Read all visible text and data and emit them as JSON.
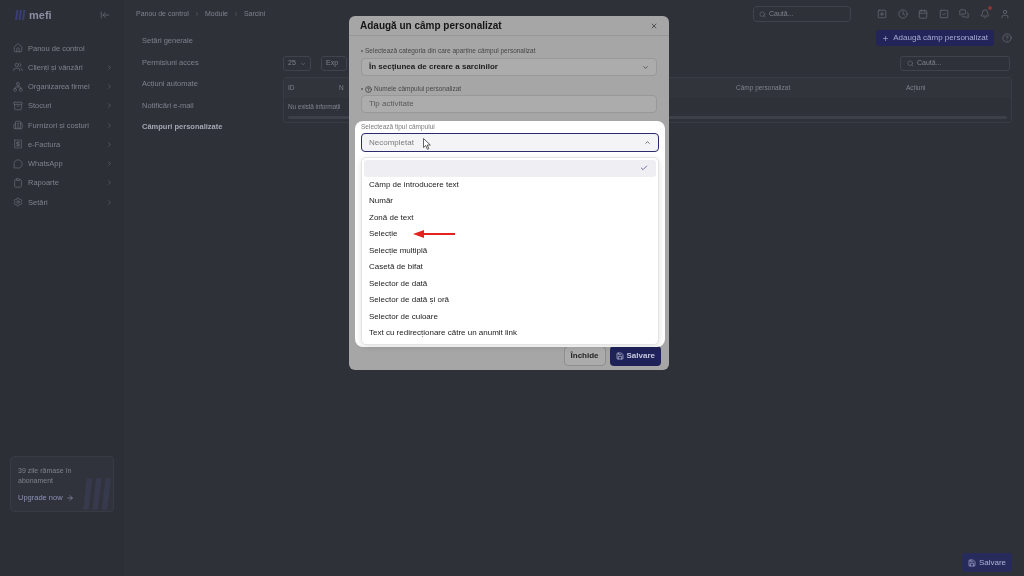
{
  "sidebar": {
    "logo": "mefi",
    "items": [
      {
        "label": "Panou de control",
        "has_submenu": false
      },
      {
        "label": "Clienți și vânzări",
        "has_submenu": true
      },
      {
        "label": "Organizarea firmei",
        "has_submenu": true
      },
      {
        "label": "Stocuri",
        "has_submenu": true
      },
      {
        "label": "Furnizori și costuri",
        "has_submenu": true
      },
      {
        "label": "e-Factura",
        "has_submenu": true
      },
      {
        "label": "WhatsApp",
        "has_submenu": true
      },
      {
        "label": "Rapoarte",
        "has_submenu": true
      },
      {
        "label": "Setări",
        "has_submenu": true
      }
    ],
    "promo": {
      "text": "39 zile rămase în abonament",
      "link": "Upgrade now"
    }
  },
  "top_bar": {
    "breadcrumb": [
      "Panou de control",
      "Module",
      "Sarcini"
    ],
    "search": {
      "placeholder": "Caută..."
    }
  },
  "settings_menu": {
    "items": [
      {
        "label": "Setări generale",
        "selected": false
      },
      {
        "label": "Permisiuni acces",
        "selected": false
      },
      {
        "label": "Acțiuni automate",
        "selected": false
      },
      {
        "label": "Notificări e-mail",
        "selected": false
      },
      {
        "label": "Câmpuri personalizate",
        "selected": true
      }
    ]
  },
  "page": {
    "add_button": "Adaugă câmp personalizat",
    "toolbar": {
      "page_size": "25",
      "export_button": "Exp",
      "search": {
        "placeholder": "Caută..."
      }
    },
    "table": {
      "columns": [
        "ID",
        "N",
        "Câmp personalizat",
        "Acțiuni"
      ],
      "empty_message": "Nu există informații"
    },
    "save_button": "Salvare"
  },
  "modal": {
    "title": "Adaugă un câmp personalizat",
    "fields": [
      {
        "kind": "select",
        "label": "Selectează categoria din care aparține câmpul personalizat",
        "required": true,
        "help": false,
        "value": "În secțiunea de creare a sarcinilor"
      },
      {
        "kind": "text",
        "label": "Numele câmpului personalizat",
        "required": true,
        "help": true,
        "placeholder": "Tip activitate"
      }
    ],
    "type_field": {
      "label": "Selectează tipul câmpului",
      "placeholder": "Necompletat",
      "expanded": true,
      "options": [
        {
          "selected": true,
          "arrow_pointer": false
        },
        {
          "label": "Câmp de introducere text",
          "selected": false,
          "arrow_pointer": false
        },
        {
          "label": "Număr",
          "selected": false,
          "arrow_pointer": false
        },
        {
          "label": "Zonă de text",
          "selected": false,
          "arrow_pointer": false
        },
        {
          "label": "Selecție",
          "selected": false,
          "arrow_pointer": true
        },
        {
          "label": "Selecție multiplă",
          "selected": false,
          "arrow_pointer": false
        },
        {
          "label": "Casetă de bifat",
          "selected": false,
          "arrow_pointer": false
        },
        {
          "label": "Selector de dată",
          "selected": false,
          "arrow_pointer": false
        },
        {
          "label": "Selector de dată și oră",
          "selected": false,
          "arrow_pointer": false
        },
        {
          "label": "Selector de culoare",
          "selected": false,
          "arrow_pointer": false
        },
        {
          "label": "Text cu redirecționare către un anumit link",
          "selected": false,
          "arrow_pointer": false
        }
      ]
    },
    "buttons": [
      {
        "label": "Închide",
        "kind": "secondary"
      },
      {
        "label": "Salvare",
        "kind": "primary"
      }
    ]
  }
}
